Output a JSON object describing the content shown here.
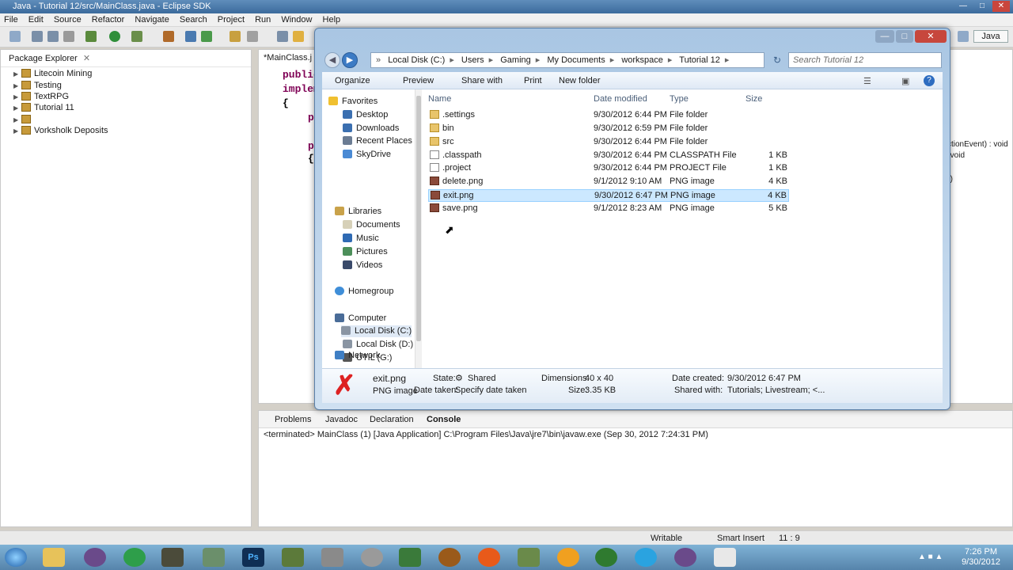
{
  "eclipse": {
    "title": "Java - Tutorial 12/src/MainClass.java - Eclipse SDK",
    "menu": [
      "File",
      "Edit",
      "Source",
      "Refactor",
      "Navigate",
      "Search",
      "Project",
      "Run",
      "Window",
      "Help"
    ],
    "perspective": "Java",
    "package_explorer": {
      "title": "Package Explorer",
      "projects": [
        "Litecoin Mining",
        "Testing",
        "TextRPG",
        "Tutorial 11",
        "",
        "Vorksholk Deposits"
      ]
    },
    "editor": {
      "tab": "*MainClass.j",
      "code_lines": [
        "public",
        "implem",
        "{",
        "pro",
        "pu",
        "{"
      ],
      "outline_fragments": [
        "ctionEvent) : void",
        ") : void",
        "(...)"
      ]
    },
    "console": {
      "tabs": [
        "Problems",
        "Javadoc",
        "Declaration",
        "Console"
      ],
      "line": "<terminated> MainClass (1) [Java Application] C:\\Program Files\\Java\\jre7\\bin\\javaw.exe (Sep 30, 2012 7:24:31 PM)"
    },
    "status": {
      "writable": "Writable",
      "insert_mode": "Smart Insert",
      "position": "11 : 9"
    }
  },
  "explorer": {
    "breadcrumb": [
      "Local Disk (C:)",
      "Users",
      "Gaming",
      "My Documents",
      "workspace",
      "Tutorial 12"
    ],
    "search_placeholder": "Search Tutorial 12",
    "commands": [
      "Organize",
      "Preview",
      "Share with",
      "Print",
      "New folder"
    ],
    "nav": {
      "favorites_label": "Favorites",
      "favorites": [
        "Desktop",
        "Downloads",
        "Recent Places",
        "SkyDrive"
      ],
      "libraries_label": "Libraries",
      "libraries": [
        "Documents",
        "Music",
        "Pictures",
        "Videos"
      ],
      "homegroup": "Homegroup",
      "computer_label": "Computer",
      "drives": [
        "Local Disk (C:)",
        "Local Disk (D:)",
        "UTIL (G:)"
      ],
      "network": "Network"
    },
    "columns": [
      "Name",
      "Date modified",
      "Type",
      "Size"
    ],
    "files": [
      {
        "name": ".settings",
        "date": "9/30/2012 6:44 PM",
        "type": "File folder",
        "size": "",
        "kind": "folder"
      },
      {
        "name": "bin",
        "date": "9/30/2012 6:59 PM",
        "type": "File folder",
        "size": "",
        "kind": "folder"
      },
      {
        "name": "src",
        "date": "9/30/2012 6:44 PM",
        "type": "File folder",
        "size": "",
        "kind": "folder"
      },
      {
        "name": ".classpath",
        "date": "9/30/2012 6:44 PM",
        "type": "CLASSPATH File",
        "size": "1 KB",
        "kind": "file"
      },
      {
        "name": ".project",
        "date": "9/30/2012 6:44 PM",
        "type": "PROJECT File",
        "size": "1 KB",
        "kind": "file"
      },
      {
        "name": "delete.png",
        "date": "9/1/2012 9:10 AM",
        "type": "PNG image",
        "size": "4 KB",
        "kind": "image"
      },
      {
        "name": "exit.png",
        "date": "9/30/2012 6:47 PM",
        "type": "PNG image",
        "size": "4 KB",
        "kind": "image"
      },
      {
        "name": "save.png",
        "date": "9/1/2012 8:23 AM",
        "type": "PNG image",
        "size": "5 KB",
        "kind": "image"
      }
    ],
    "details": {
      "filename": "exit.png",
      "filetype": "PNG image",
      "state_label": "State:",
      "state_value": "Shared",
      "date_taken_label": "Date taken:",
      "date_taken_value": "Specify date taken",
      "dimensions_label": "Dimensions:",
      "dimensions_value": "40 x 40",
      "size_label": "Size:",
      "size_value": "3.35 KB",
      "date_created_label": "Date created:",
      "date_created_value": "9/30/2012 6:47 PM",
      "shared_with_label": "Shared with:",
      "shared_with_value": "Tutorials; Livestream; <..."
    }
  },
  "taskbar": {
    "time": "7:26 PM",
    "date": "9/30/2012"
  },
  "colors": {
    "selection": "#cce8ff",
    "folder": "#e8c46a",
    "taskbar": "#5684ab"
  }
}
